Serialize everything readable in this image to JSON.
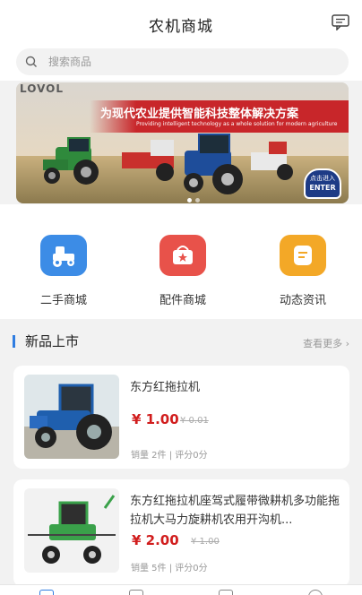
{
  "header": {
    "title": "农机商城",
    "message_icon": "message-icon"
  },
  "search": {
    "placeholder": "搜索商品"
  },
  "banner": {
    "logo_text": "LOVOL",
    "headline": "为现代农业提供智能科技整体解决方案",
    "subline": "Providing intelligent technology as a whole solution for modern agriculture",
    "enter_line1": "点击进入",
    "enter_line2": "ENTER"
  },
  "categories": [
    {
      "label": "二手商城",
      "icon": "tractor-icon",
      "color": "#3c8ce6"
    },
    {
      "label": "配件商城",
      "icon": "shop-bag-icon",
      "color": "#e8524a"
    },
    {
      "label": "动态资讯",
      "icon": "news-icon",
      "color": "#f3a827"
    }
  ],
  "section": {
    "title": "新品上市",
    "more": "查看更多"
  },
  "products": [
    {
      "name": "东方红拖拉机",
      "price": "¥ 1.00",
      "old_price": "¥ 0.01",
      "meta": "销量 2件 | 评分0分"
    },
    {
      "name": "东方红拖拉机座驾式履带微耕机多功能拖拉机大马力旋耕机农用开沟机...",
      "price": "¥ 2.00",
      "old_price": "¥ 1.00",
      "meta": "销量 5件 | 评分0分"
    }
  ],
  "colors": {
    "accent": "#2f7de1",
    "price": "#d11d1d"
  }
}
